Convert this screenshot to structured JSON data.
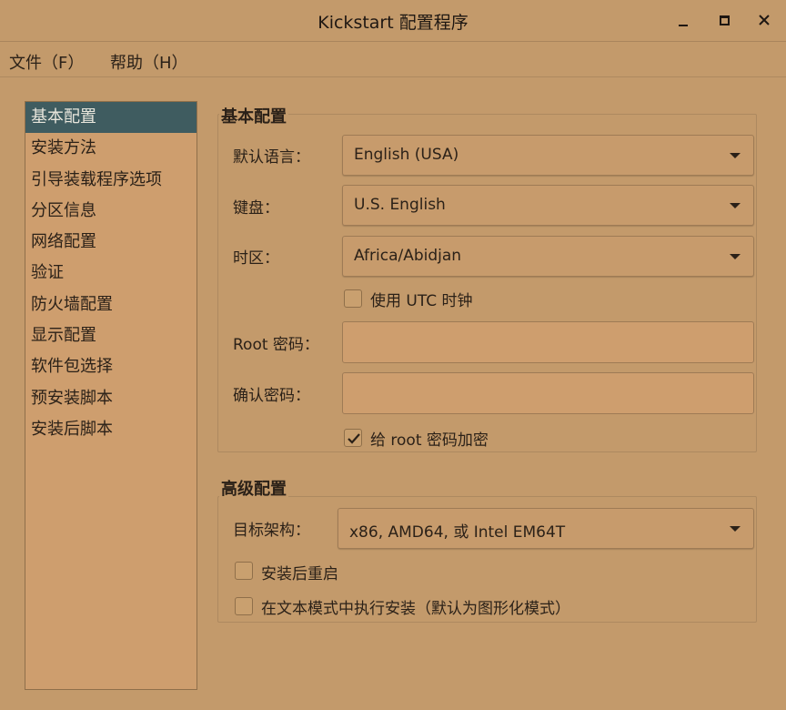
{
  "window": {
    "title": "Kickstart 配置程序"
  },
  "menubar": {
    "file": "文件（F）",
    "help": "帮助（H）"
  },
  "sidebar": {
    "items": [
      {
        "label": "基本配置",
        "selected": true
      },
      {
        "label": "安装方法"
      },
      {
        "label": "引导装载程序选项"
      },
      {
        "label": "分区信息"
      },
      {
        "label": "网络配置"
      },
      {
        "label": "验证"
      },
      {
        "label": "防火墙配置"
      },
      {
        "label": "显示配置"
      },
      {
        "label": "软件包选择"
      },
      {
        "label": "预安装脚本"
      },
      {
        "label": "安装后脚本"
      }
    ]
  },
  "basic": {
    "title": "基本配置",
    "language_label": "默认语言：",
    "language_value": "English (USA)",
    "keyboard_label": "键盘：",
    "keyboard_value": "U.S. English",
    "timezone_label": "时区：",
    "timezone_value": "Africa/Abidjan",
    "utc_label": "使用  UTC 时钟",
    "utc_checked": false,
    "root_pw_label": "Root 密码：",
    "root_pw_value": "",
    "confirm_pw_label": "确认密码：",
    "confirm_pw_value": "",
    "encrypt_label": "给  root 密码加密",
    "encrypt_checked": true
  },
  "advanced": {
    "title": "高级配置",
    "arch_label": "目标架构：",
    "arch_value": "x86, AMD64, 或  Intel EM64T",
    "reboot_label": "安装后重启",
    "reboot_checked": false,
    "textmode_label": "在文本模式中执行安装（默认为图形化模式）",
    "textmode_checked": false
  },
  "colors": {
    "background": "#C39A6B",
    "selection": "#3F5C60",
    "text": "#2B2118"
  }
}
